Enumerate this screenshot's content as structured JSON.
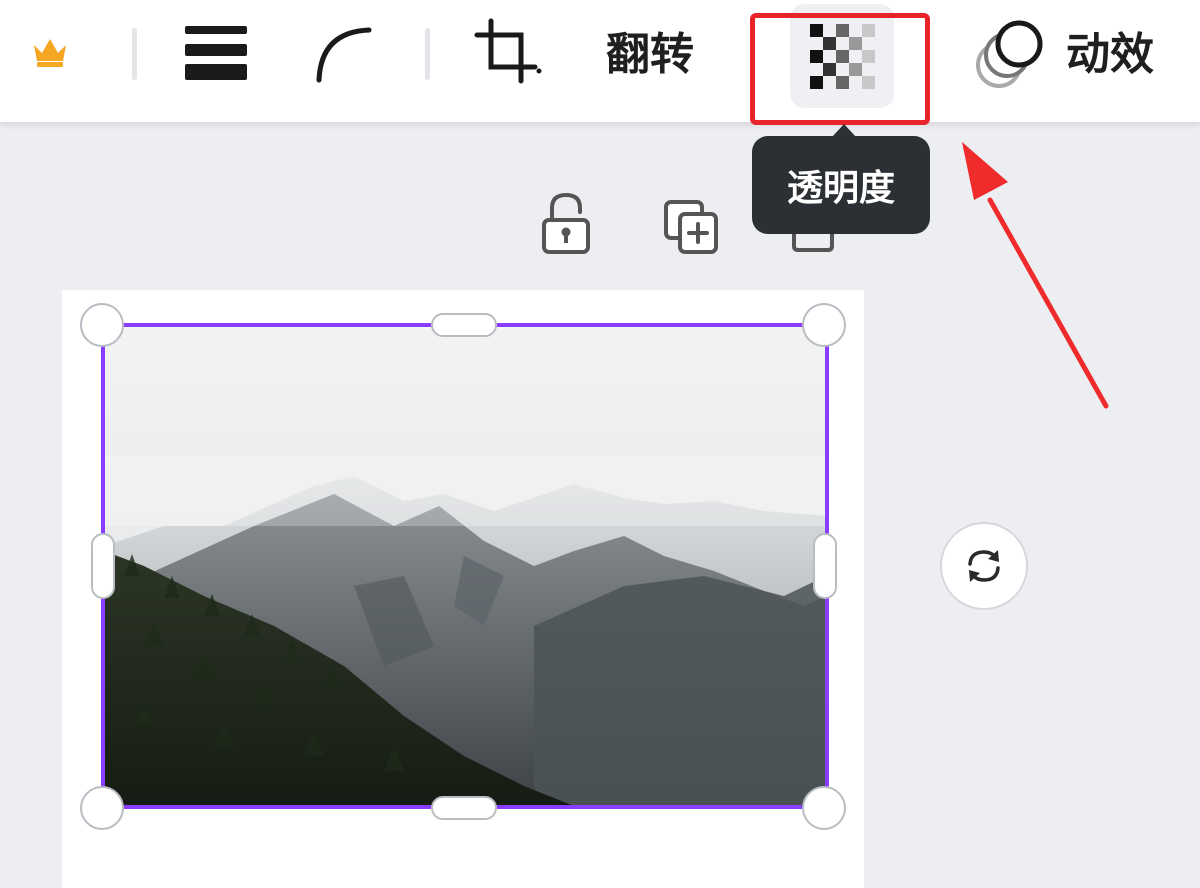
{
  "toolbar": {
    "flip_label": "翻转",
    "animate_label": "动效",
    "transparency_tooltip": "透明度"
  },
  "icons": {
    "crown": "crown-icon",
    "line_weight": "line-weight-icon",
    "corner_rounding": "corner-rounding-icon",
    "crop": "crop-icon",
    "transparency": "transparency-checker-icon",
    "animate": "animate-circles-icon",
    "lock": "unlock-icon",
    "duplicate": "duplicate-icon",
    "delete": "delete-icon",
    "rotate": "rotate-icon"
  },
  "colors": {
    "selection": "#8b3dff",
    "highlight": "#e8232a",
    "crown": "#f5a623",
    "tooltip_bg": "#2c2f33"
  }
}
